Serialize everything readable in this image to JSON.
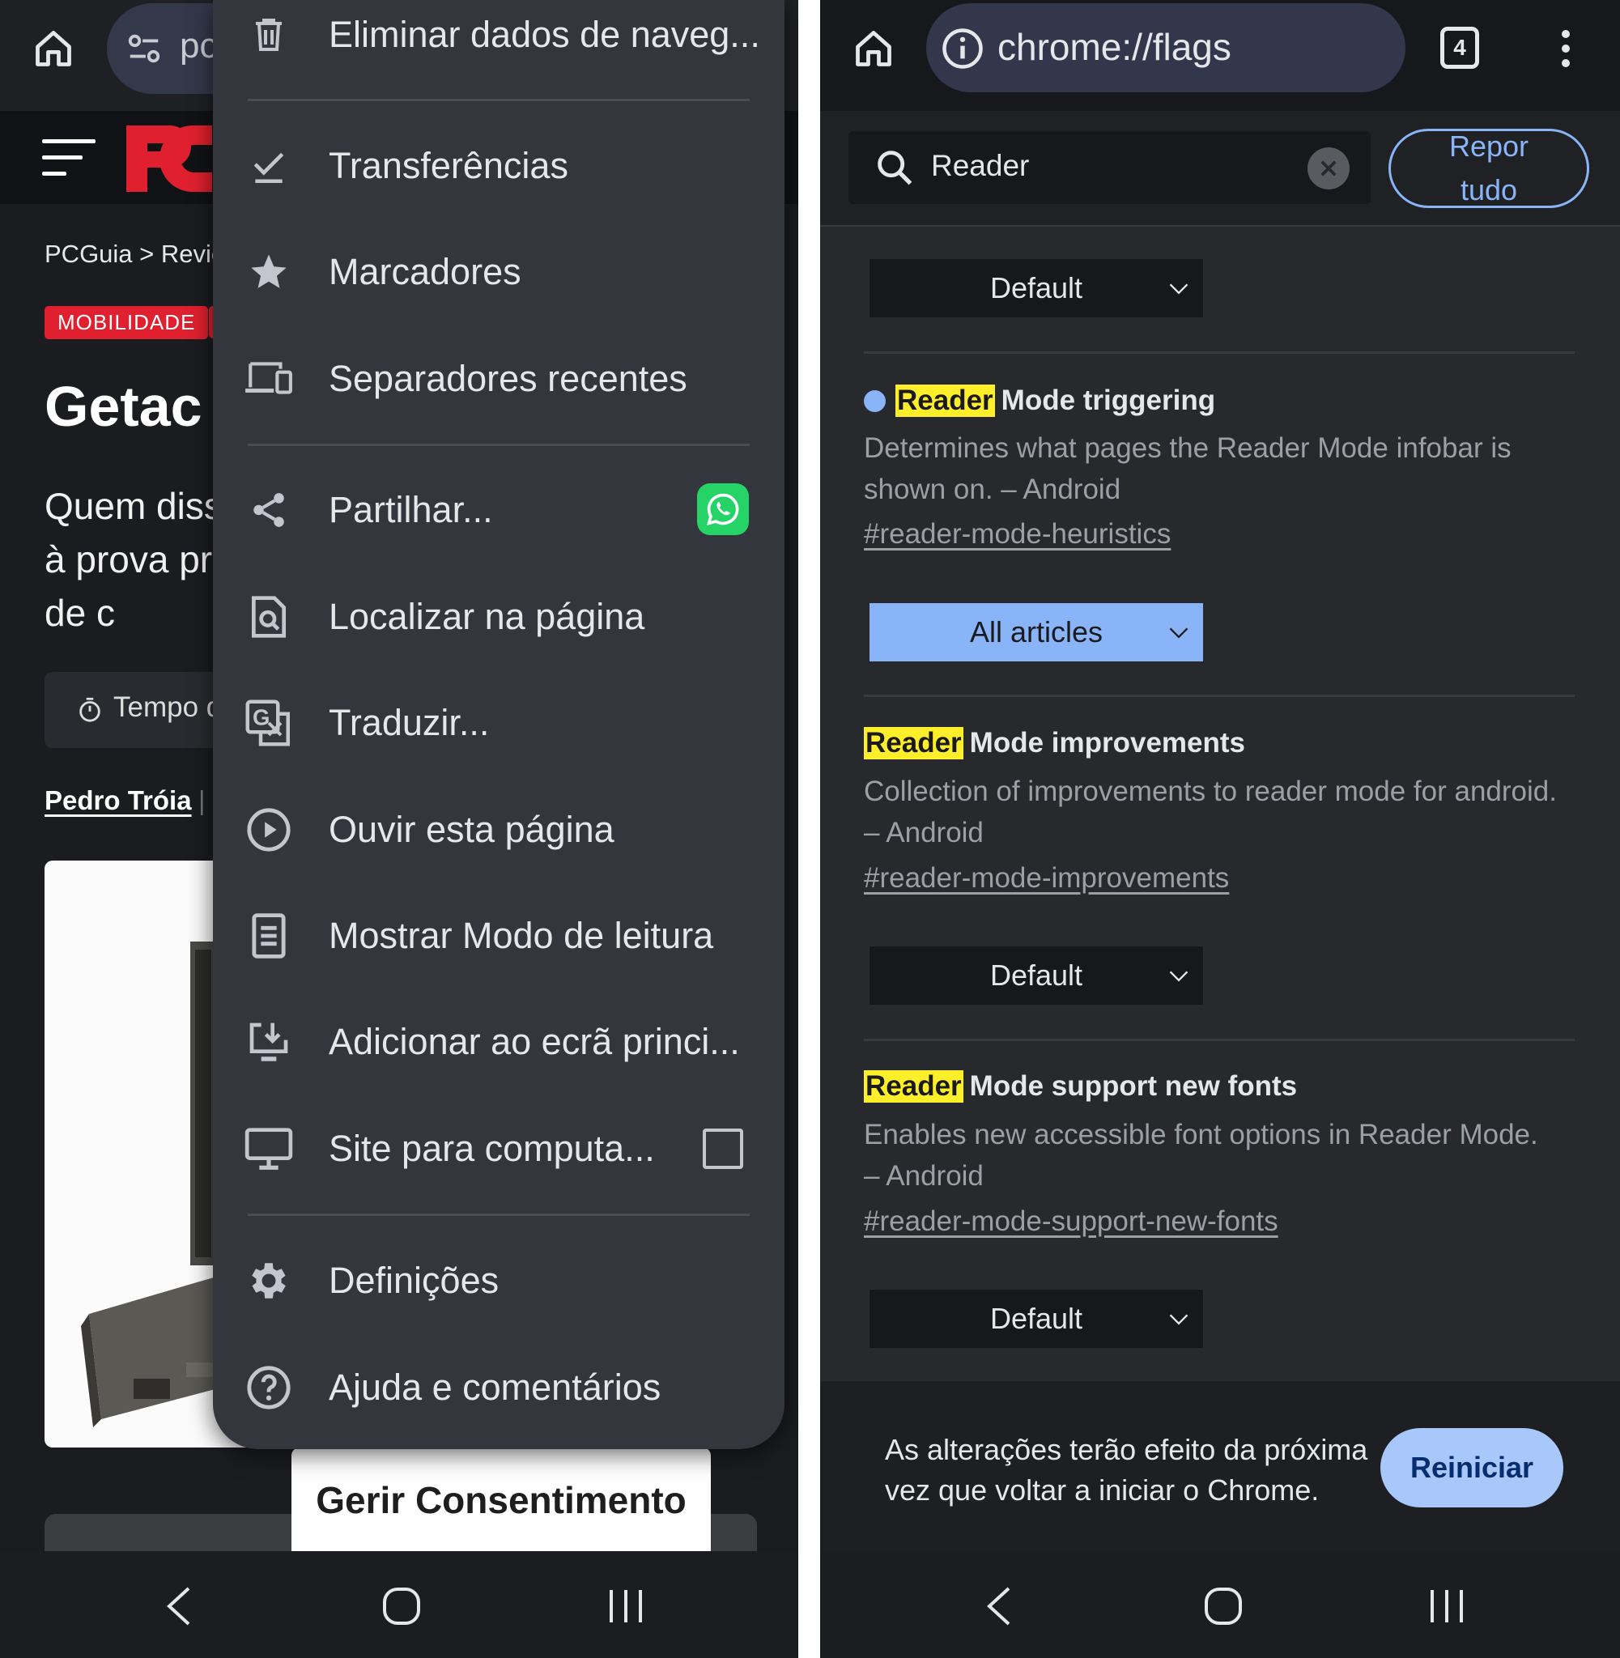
{
  "left": {
    "omnibox_text": "pc",
    "crumb": "PCGuia > Review",
    "badge": "MOBILIDADE",
    "headline": "Getac V",
    "lede": "Quem diss ser à prova prova de c",
    "read_time": "Tempo d",
    "author": "Pedro Tróia",
    "author_sep": "|",
    "consent_label": "Gerir Consentimento",
    "menu": [
      {
        "label": "Eliminar dados de naveg...",
        "icon": "trash-icon"
      },
      {
        "label": "Transferências",
        "icon": "download-check-icon"
      },
      {
        "label": "Marcadores",
        "icon": "star-icon"
      },
      {
        "label": "Separadores recentes",
        "icon": "devices-icon"
      },
      {
        "label": "Partilhar...",
        "icon": "share-icon"
      },
      {
        "label": "Localizar na página",
        "icon": "find-in-page-icon"
      },
      {
        "label": "Traduzir...",
        "icon": "translate-icon"
      },
      {
        "label": "Ouvir esta página",
        "icon": "play-circle-icon"
      },
      {
        "label": "Mostrar Modo de leitura",
        "icon": "reader-mode-icon"
      },
      {
        "label": "Adicionar ao ecrã princi...",
        "icon": "add-to-home-icon"
      },
      {
        "label": "Site para computa...",
        "icon": "desktop-icon"
      },
      {
        "label": "Definições",
        "icon": "gear-icon"
      },
      {
        "label": "Ajuda e comentários",
        "icon": "help-icon"
      }
    ]
  },
  "right": {
    "url": "chrome://flags",
    "tab_count": "4",
    "search_value": "Reader",
    "reset_label_line1": "Repor",
    "reset_label_line2": "tudo",
    "top_select": "Default",
    "flags": [
      {
        "highlight": "Reader",
        "title_rest": "Mode triggering",
        "description": "Determines what pages the Reader Mode infobar is shown on. – Android",
        "link": "#reader-mode-heuristics",
        "selected": "All articles",
        "modified": true
      },
      {
        "highlight": "Reader",
        "title_rest": "Mode improvements",
        "description": "Collection of improvements to reader mode for android. – Android",
        "link": "#reader-mode-improvements",
        "selected": "Default",
        "modified": false
      },
      {
        "highlight": "Reader",
        "title_rest": "Mode support new fonts",
        "description": "Enables new accessible font options in Reader Mode. – Android",
        "link": "#reader-mode-support-new-fonts",
        "selected": "Default",
        "modified": false
      }
    ],
    "footer_message": "As alterações terão efeito da próxima vez que voltar a iniciar o Chrome.",
    "restart_label": "Reiniciar"
  },
  "colors": {
    "accent_blue": "#8ab4f8",
    "highlight_yellow": "#ffef2a",
    "brand_red": "#e0202e",
    "whatsapp_green": "#25d366"
  }
}
